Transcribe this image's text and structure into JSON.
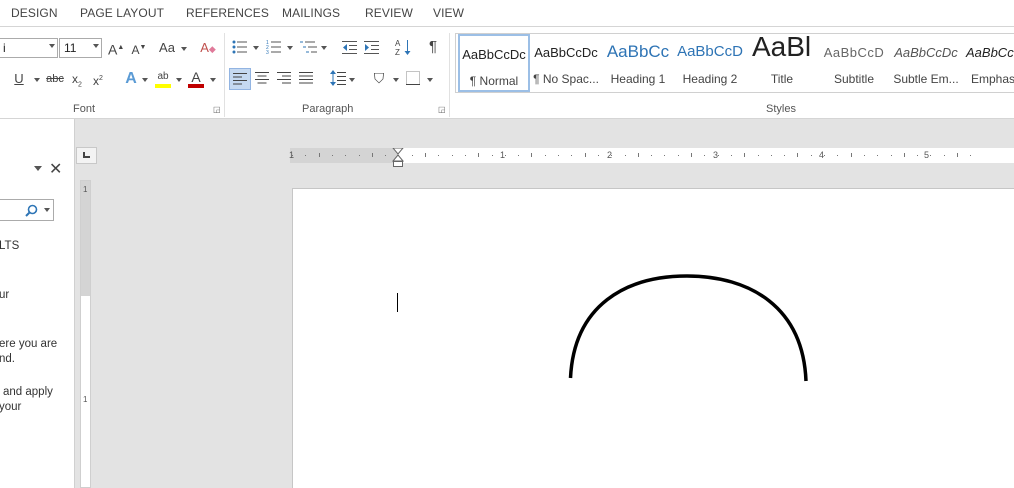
{
  "tabs": [
    "DESIGN",
    "PAGE LAYOUT",
    "REFERENCES",
    "MAILINGS",
    "REVIEW",
    "VIEW"
  ],
  "font": {
    "name_value": "i",
    "size_value": "11",
    "group_label": "Font"
  },
  "paragraph": {
    "group_label": "Paragraph"
  },
  "styles": {
    "group_label": "Styles",
    "items": [
      {
        "preview": "AaBbCcDc",
        "name": "¶ Normal"
      },
      {
        "preview": "AaBbCcDc",
        "name": "¶ No Spac..."
      },
      {
        "preview": "AaBbCc",
        "name": "Heading 1"
      },
      {
        "preview": "AaBbCcD",
        "name": "Heading 2"
      },
      {
        "preview": "AaBl",
        "name": "Title"
      },
      {
        "preview": "AaBbCcD",
        "name": "Subtitle"
      },
      {
        "preview": "AaBbCcDc",
        "name": "Subtle Em..."
      },
      {
        "preview": "AaBbCc",
        "name": "Emphas"
      }
    ]
  },
  "nav_pane": {
    "lines": [
      "LTS",
      "ur",
      "ere you are",
      "nd.",
      "and apply",
      "your"
    ]
  },
  "ruler": {
    "numbers": [
      "1",
      "1",
      "1",
      "2",
      "3",
      "4",
      "5"
    ],
    "vnumbers": [
      "1",
      "1"
    ]
  },
  "colors": {
    "highlight": "#ffff00",
    "font_color": "#c00000",
    "selected": "#c5d9f1"
  }
}
